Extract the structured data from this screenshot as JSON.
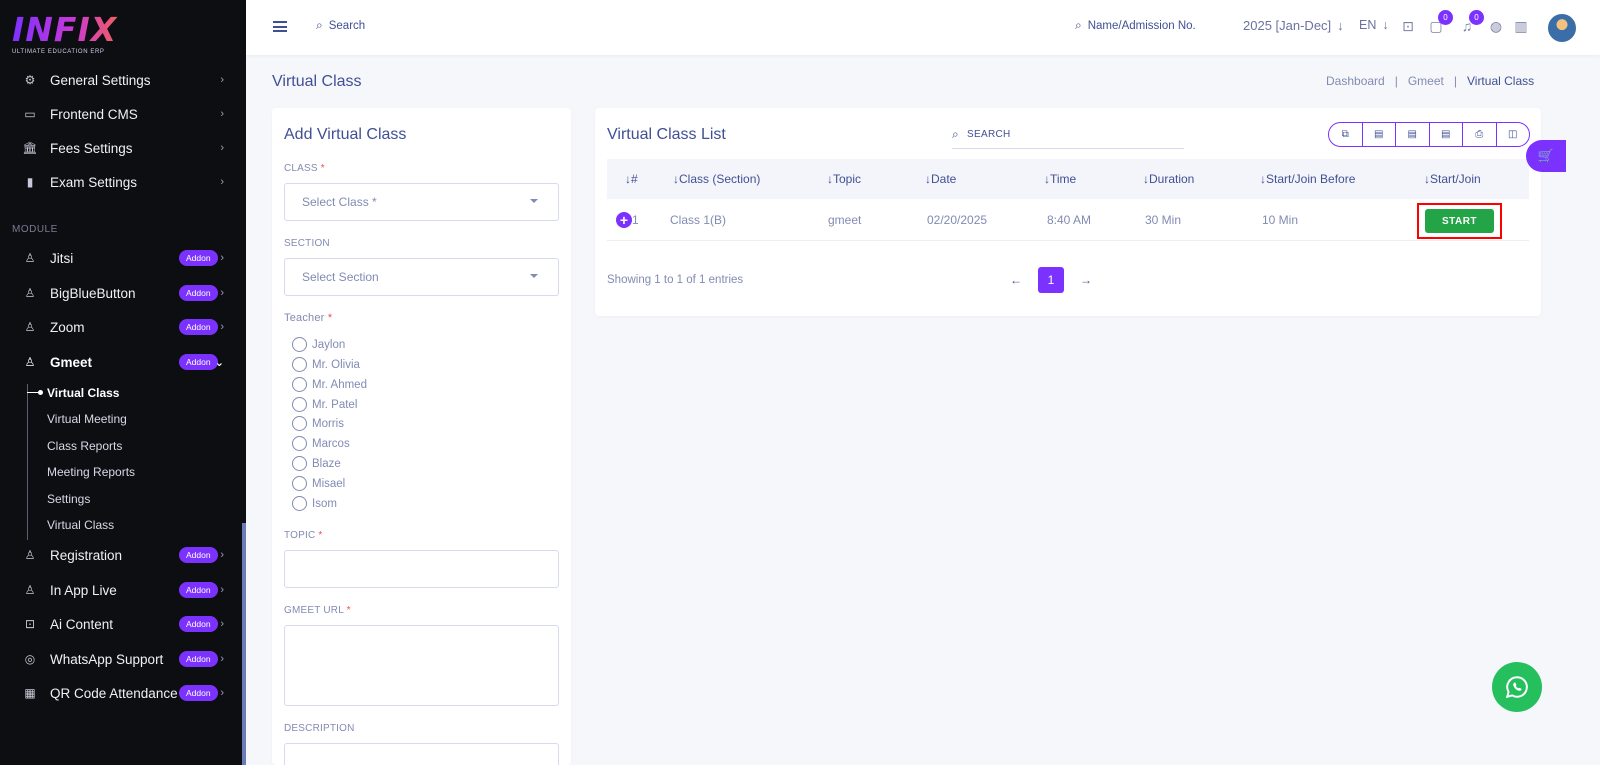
{
  "app": {
    "logo_text": "INFIX",
    "logo_sub": "ULTIMATE EDUCATION ERP"
  },
  "sidebar": {
    "settings_items": [
      {
        "label": "General Settings",
        "icon": "gears-icon"
      },
      {
        "label": "Frontend CMS",
        "icon": "monitor-icon"
      },
      {
        "label": "Fees Settings",
        "icon": "bank-icon"
      },
      {
        "label": "Exam Settings",
        "icon": "book-icon"
      }
    ],
    "module_label": "MODULE",
    "addon_label": "Addon",
    "modules": [
      {
        "label": "Jitsi"
      },
      {
        "label": "BigBlueButton"
      },
      {
        "label": "Zoom"
      },
      {
        "label": "Gmeet"
      }
    ],
    "gmeet_sub": [
      "Virtual Class",
      "Virtual Meeting",
      "Class Reports",
      "Meeting Reports",
      "Settings",
      "Virtual Class"
    ],
    "more_modules": [
      {
        "label": "Registration",
        "icon": "person-icon"
      },
      {
        "label": "In App Live",
        "icon": "person-icon"
      },
      {
        "label": "Ai Content",
        "icon": "robot-icon"
      },
      {
        "label": "WhatsApp Support",
        "icon": "whatsapp-icon"
      },
      {
        "label": "QR Code Attendance",
        "icon": "qr-icon"
      }
    ]
  },
  "topbar": {
    "search_label": "Search",
    "student_search": "Name/Admission No.",
    "session": "2025 [Jan-Dec]",
    "language": "EN",
    "chat_count": "0",
    "notif_count": "0"
  },
  "page": {
    "title": "Virtual Class",
    "breadcrumb": [
      "Dashboard",
      "Gmeet",
      "Virtual Class"
    ]
  },
  "form": {
    "title": "Add Virtual Class",
    "class_label": "CLASS",
    "class_placeholder": "Select Class *",
    "section_label": "SECTION",
    "section_placeholder": "Select Section",
    "teacher_label": "Teacher",
    "teachers": [
      "Jaylon",
      "Mr. Olivia",
      "Mr. Ahmed",
      "Mr. Patel",
      "Morris",
      "Marcos",
      "Blaze",
      "Misael",
      "Isom"
    ],
    "topic_label": "TOPIC",
    "gmeet_url_label": "GMEET URL",
    "description_label": "DESCRIPTION"
  },
  "list": {
    "title": "Virtual Class List",
    "search_placeholder": "SEARCH",
    "export_icons": [
      "copy-icon",
      "excel-icon",
      "csv-icon",
      "pdf-icon",
      "print-icon",
      "columns-icon"
    ],
    "columns": [
      "#",
      "Class (Section)",
      "Topic",
      "Date",
      "Time",
      "Duration",
      "Start/Join Before",
      "Start/Join"
    ],
    "rows": [
      {
        "no": "1",
        "class": "Class 1(B)",
        "topic": "gmeet",
        "date": "02/20/2025",
        "time": "8:40 AM",
        "duration": "30 Min",
        "before": "10 Min",
        "action": "START"
      }
    ],
    "showing": "Showing 1 to 1 of 1 entries",
    "page": "1"
  },
  "colors": {
    "accent": "#7c32ff",
    "start_button": "#22a447",
    "highlight": "#ff0000",
    "whatsapp": "#25c05d"
  }
}
